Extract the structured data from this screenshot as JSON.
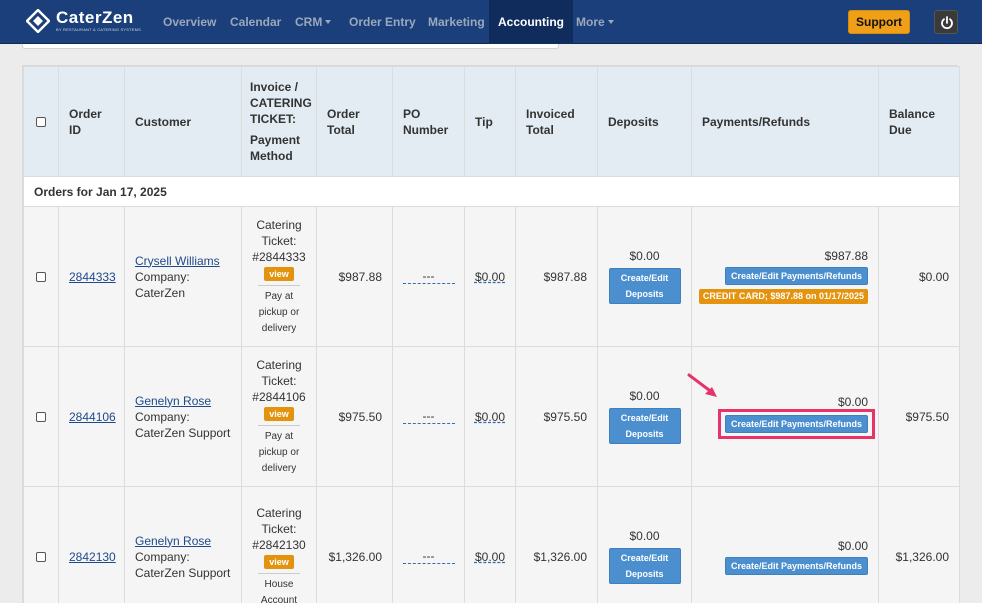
{
  "brand": {
    "name": "CaterZen",
    "tagline": "BY RESTAURANT & CATERING SYSTEMS"
  },
  "nav": {
    "overview": "Overview",
    "calendar": "Calendar",
    "crm": "CRM",
    "order_entry": "Order Entry",
    "marketing": "Marketing",
    "accounting": "Accounting",
    "more": "More",
    "support": "Support"
  },
  "table": {
    "headers": {
      "order_id": "Order ID",
      "customer": "Customer",
      "invoice_line1": "Invoice / CATERING TICKET:",
      "invoice_line2": "Payment Method",
      "order_total": "Order Total",
      "po_number": "PO Number",
      "tip": "Tip",
      "invoiced_total": "Invoiced Total",
      "deposits": "Deposits",
      "payments": "Payments/Refunds",
      "balance_due": "Balance Due"
    },
    "group_label": "Orders for Jan 17, 2025",
    "company_label": "Company:",
    "view_label": "view",
    "po_placeholder": "---",
    "deposit_button": "Create/Edit Deposits",
    "payment_button": "Create/Edit Payments/Refunds",
    "rows": [
      {
        "order_id": "2844333",
        "customer_name": "Crysell Williams",
        "company": "CaterZen",
        "ticket_label": "Catering Ticket: #2844333",
        "payment_method": "Pay at pickup or delivery",
        "order_total": "$987.88",
        "tip": "$0.00",
        "invoiced_total": "$987.88",
        "deposit_amount": "$0.00",
        "payment_amount": "$987.88",
        "payment_tag": "CREDIT CARD; $987.88 on 01/17/2025",
        "balance_due": "$0.00"
      },
      {
        "order_id": "2844106",
        "customer_name": "Genelyn Rose",
        "company": "CaterZen Support",
        "ticket_label": "Catering Ticket: #2844106",
        "payment_method": "Pay at pickup or delivery",
        "order_total": "$975.50",
        "tip": "$0.00",
        "invoiced_total": "$975.50",
        "deposit_amount": "$0.00",
        "payment_amount": "$0.00",
        "balance_due": "$975.50"
      },
      {
        "order_id": "2842130",
        "customer_name": "Genelyn Rose",
        "company": "CaterZen Support",
        "ticket_label": "Catering Ticket: #2842130",
        "payment_method": "House Account",
        "order_total": "$1,326.00",
        "tip": "$0.00",
        "invoiced_total": "$1,326.00",
        "deposit_amount": "$0.00",
        "payment_amount": "$0.00",
        "balance_due": "$1,326.00"
      }
    ]
  },
  "colors": {
    "nav_bg": "#1b3f7a",
    "support": "#f0a018",
    "highlight": "#e8336a",
    "button_blue": "#4b8fcf",
    "tag_orange": "#e4930f"
  }
}
